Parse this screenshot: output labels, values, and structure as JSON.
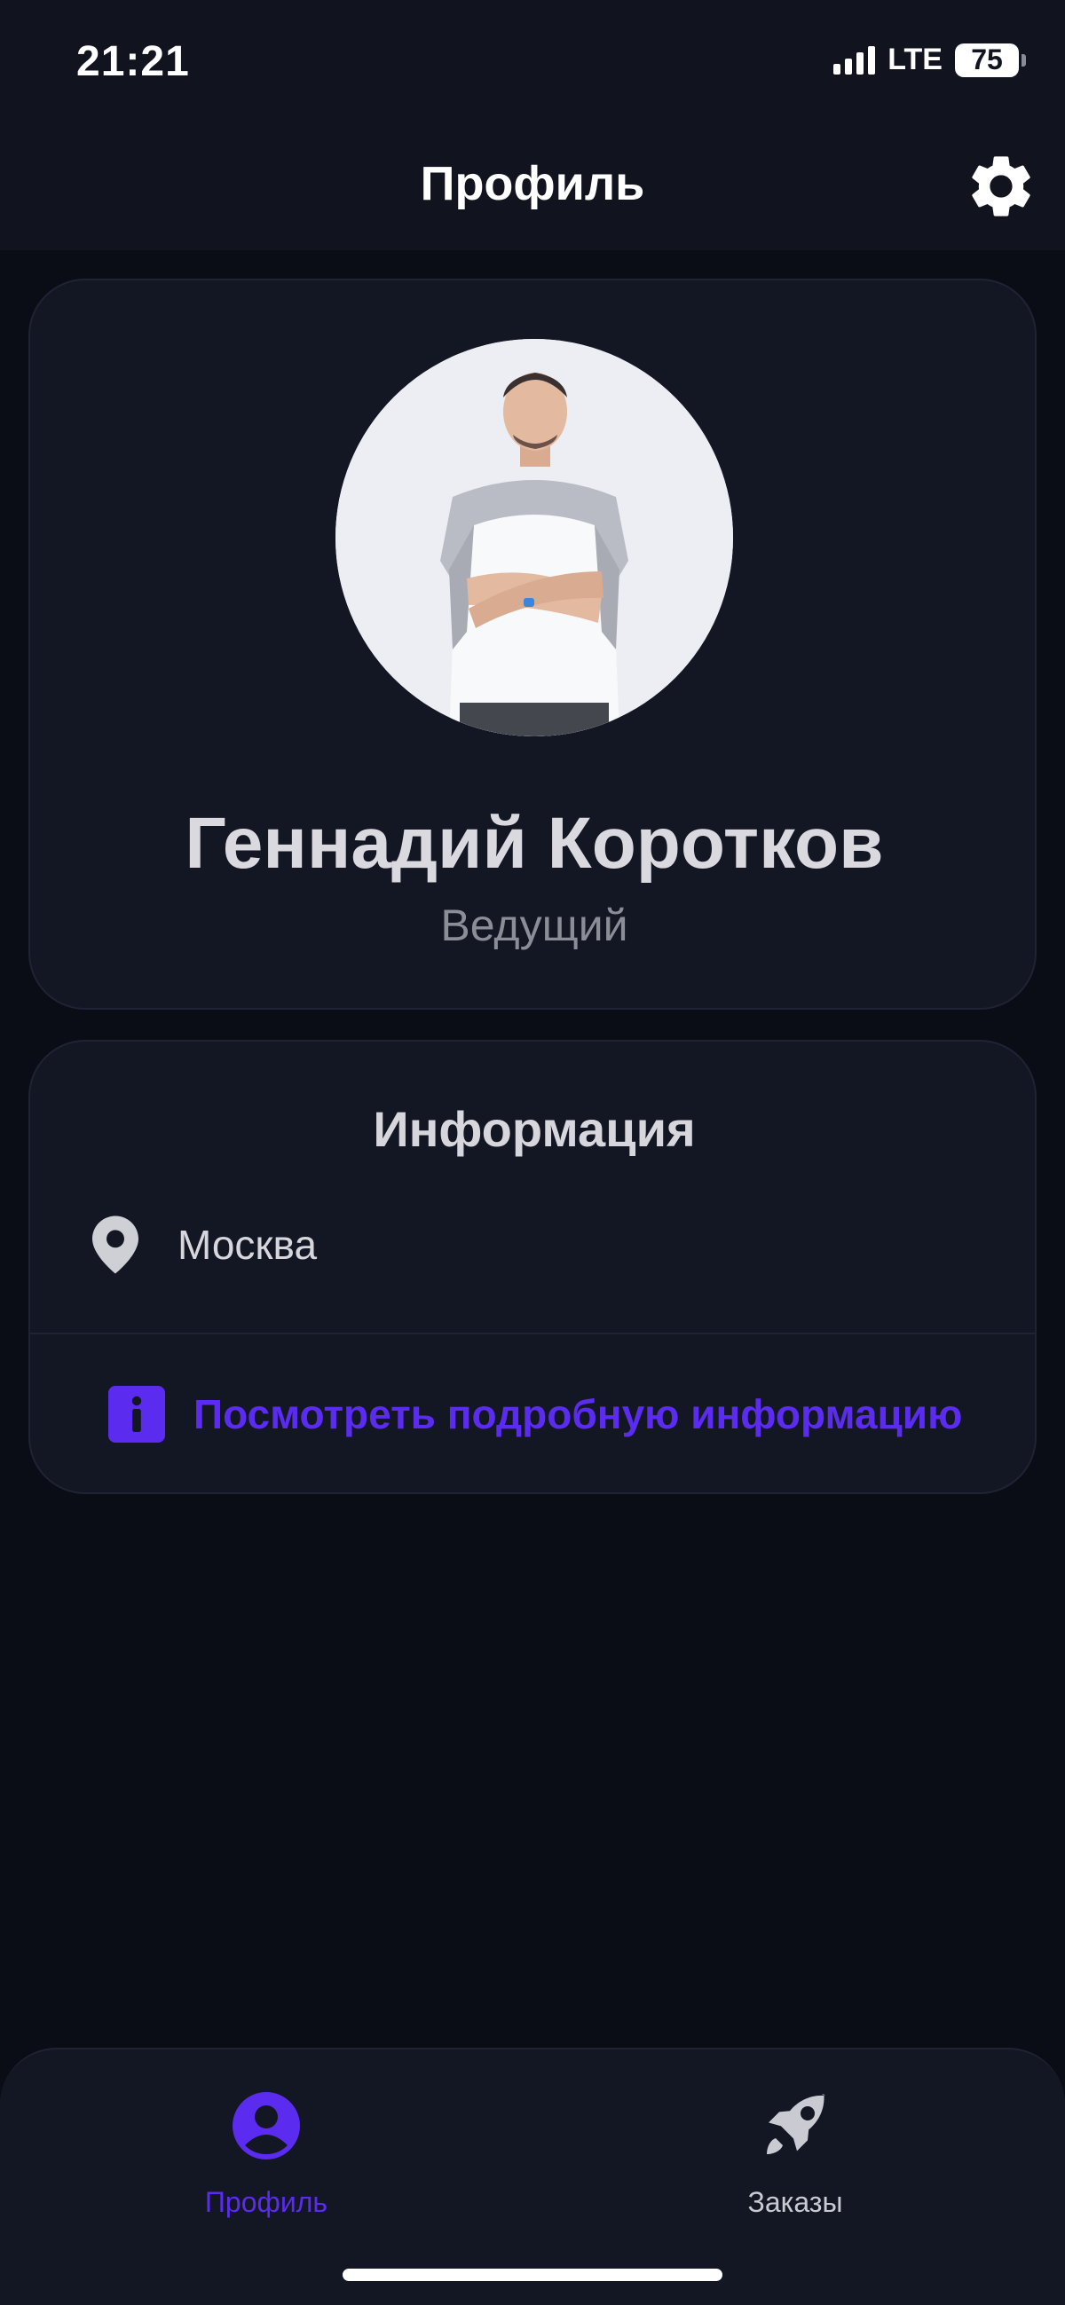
{
  "status_bar": {
    "time": "21:21",
    "network": "LTE",
    "battery": "75",
    "signal_bars": 4
  },
  "header": {
    "title": "Профиль",
    "settings_icon": "gear-icon"
  },
  "profile": {
    "name": "Геннадий Коротков",
    "role": "Ведущий"
  },
  "info": {
    "title": "Информация",
    "location_icon": "map-pin-icon",
    "city": "Москва",
    "details_icon": "info-icon",
    "details_link": "Посмотреть подробную информацию"
  },
  "tabbar": {
    "tabs": [
      {
        "label": "Профиль",
        "icon": "user-circle-icon",
        "active": true
      },
      {
        "label": "Заказы",
        "icon": "rocket-icon",
        "active": false
      }
    ]
  },
  "colors": {
    "background": "#0b0d16",
    "card": "#131623",
    "accent": "#5b2cf0",
    "text": "#d6d6dc",
    "muted": "#8b8d97"
  }
}
